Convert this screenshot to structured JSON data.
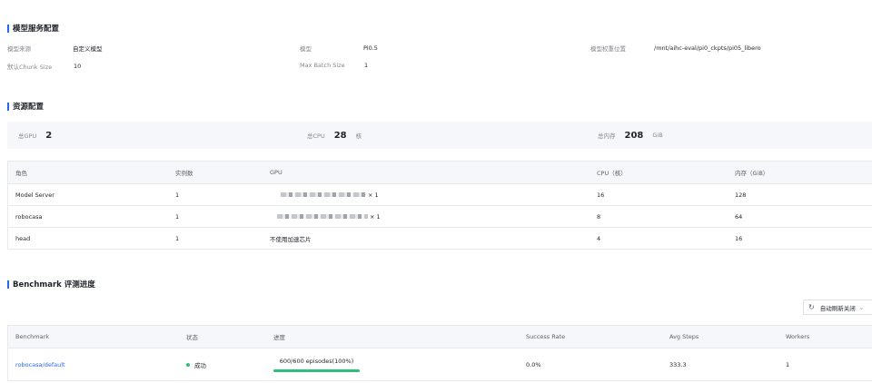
{
  "model_config": {
    "title": "模型服务配置",
    "fields": [
      {
        "label": "模型来源",
        "value": "自定义模型"
      },
      {
        "label": "模型",
        "value": "Pi0.5"
      },
      {
        "label": "模型权重位置",
        "value": "/mnt/aihc-eval/pi0_ckpts/pi05_libero"
      },
      {
        "label": "默认Chunk Size",
        "value": "10"
      },
      {
        "label": "Max Batch Size",
        "value": "1"
      }
    ]
  },
  "resource_config": {
    "title": "资源配置",
    "summary": {
      "gpu_label": "总GPU",
      "gpu_value": "2",
      "cpu_label": "总CPU",
      "cpu_value": "28",
      "cpu_unit": "核",
      "mem_label": "总内存",
      "mem_value": "208",
      "mem_unit": "GiB"
    },
    "columns": [
      "角色",
      "实例数",
      "GPU",
      "CPU（核）",
      "内存（GiB）"
    ],
    "rows": [
      {
        "role": "Model Server",
        "instances": "1",
        "gpu": "× 1",
        "gpu_masked": true,
        "cpu": "16",
        "mem": "128"
      },
      {
        "role": "robocasa",
        "instances": "1",
        "gpu": "× 1",
        "gpu_masked": true,
        "cpu": "8",
        "mem": "64"
      },
      {
        "role": "head",
        "instances": "1",
        "gpu": "不使用加速芯片",
        "gpu_masked": false,
        "cpu": "4",
        "mem": "16"
      }
    ]
  },
  "benchmark": {
    "title": "Benchmark 评测进度",
    "refresh_label": "自动刷新关闭",
    "columns": [
      "Benchmark",
      "状态",
      "进度",
      "Success Rate",
      "Avg Steps",
      "Workers"
    ],
    "rows": [
      {
        "name": "robocasa/default",
        "status": "成功",
        "progress_text": "600/600 episodes(100%)",
        "progress_fraction": 1.0,
        "success_rate": "0.0%",
        "avg_steps": "333.3",
        "workers": "1"
      }
    ],
    "colors": {
      "link": "#2468f2",
      "success": "#30bf78",
      "accent": "#2468f2"
    }
  }
}
